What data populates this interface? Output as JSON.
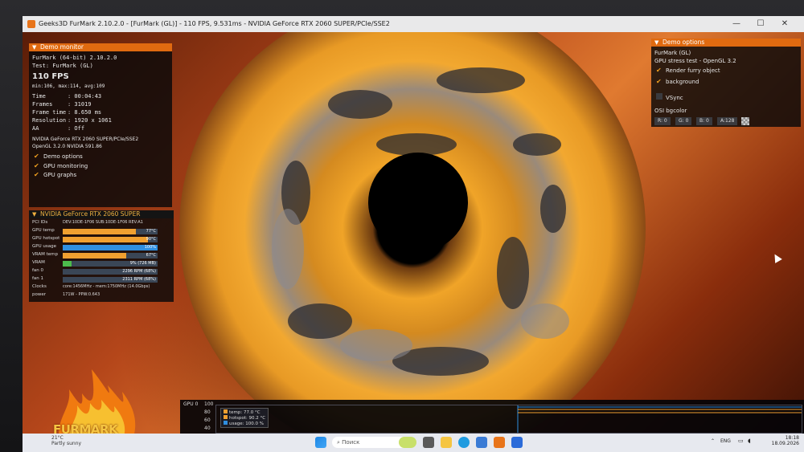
{
  "window": {
    "title": "Geeks3D FurMark 2.10.2.0 - [FurMark (GL)] - 110 FPS, 9.531ms - NVIDIA GeForce RTX 2060 SUPER/PCIe/SSE2"
  },
  "demo_monitor": {
    "header": "Demo monitor",
    "app_line": "FurMark (64-bit) 2.10.2.0",
    "test_line": "Test: FurMark (GL)",
    "fps": "110 FPS",
    "fps_stats": "min:106, max:114, avg:109",
    "stats": [
      {
        "label": "Time",
        "value": ": 00:04:43"
      },
      {
        "label": "Frames",
        "value": ": 31019"
      },
      {
        "label": "Frame time",
        "value": ": 8.650 ms"
      },
      {
        "label": "Resolution",
        "value": ": 1920 x 1061"
      },
      {
        "label": "AA",
        "value": ": Off"
      }
    ],
    "renderer": "NVIDIA GeForce RTX 2060 SUPER/PCIe/SSE2",
    "opengl": "OpenGL 3.2.0 NVIDIA 591.86",
    "checks": [
      {
        "label": "Demo options",
        "checked": true
      },
      {
        "label": "GPU monitoring",
        "checked": true
      },
      {
        "label": "GPU graphs",
        "checked": true
      }
    ]
  },
  "gpu_monitor": {
    "header": "NVIDIA GeForce RTX 2060 SUPER",
    "rows": [
      {
        "label": "PCI IDs",
        "text": "DEV:10DE-1F06 SUB:10DE-1F06 REV:A1"
      },
      {
        "label": "GPU temp",
        "value": "77°C",
        "level": 0.77,
        "color": "#f0a030"
      },
      {
        "label": "GPU hotspot",
        "value": "90°C",
        "level": 0.9,
        "color": "#f0a030"
      },
      {
        "label": "GPU usage",
        "value": "100%",
        "level": 1.0,
        "color": "#2f8fe0"
      },
      {
        "label": "VRAM temp",
        "value": "67°C",
        "level": 0.67,
        "color": "#f0a030"
      },
      {
        "label": "VRAM",
        "value": "9% (726 MB)",
        "level": 0.09,
        "color": "#4cbc4c"
      },
      {
        "label": "fan 0",
        "value": "2296 RPM (68%)",
        "level": 0.0,
        "color": "#3a4656"
      },
      {
        "label": "fan 1",
        "value": "2311 RPM (68%)",
        "level": 0.0,
        "color": "#3a4656"
      },
      {
        "label": "Clocks",
        "text": "core:1456MHz - mem:1750MHz (14.0Gbps)"
      },
      {
        "label": "power",
        "text": "171W - PPW:0.643"
      }
    ]
  },
  "demo_options": {
    "header": "Demo options",
    "api_line": "FurMark (GL)",
    "desc_line": "GPU stress test - OpenGL 3.2",
    "checks": [
      {
        "label": "Render furry object",
        "checked": true
      },
      {
        "label": "background",
        "checked": true
      },
      {
        "label": "VSync",
        "checked": false
      }
    ],
    "bgcolor_label": "OSI bgcolor",
    "bgcolor": {
      "r": "R: 0",
      "g": "G: 0",
      "b": "B: 0",
      "a": "A:128"
    }
  },
  "logo_text": "FURMARK",
  "graph": {
    "title": "GPU 0",
    "yticks": [
      "100",
      "80",
      "60",
      "40"
    ],
    "legend": [
      {
        "label": "temp: 77.0 °C",
        "color": "#f0a030"
      },
      {
        "label": "hotspot: 90.2 °C",
        "color": "#f0a030"
      },
      {
        "label": "usage: 100.0 %",
        "color": "#2f8fe0"
      }
    ]
  },
  "taskbar": {
    "weather_temp": "21°C",
    "weather_desc": "Partly sunny",
    "search_placeholder": "Поиск",
    "lang": "ENG",
    "time": "18:18",
    "date": "18.09.2026"
  }
}
